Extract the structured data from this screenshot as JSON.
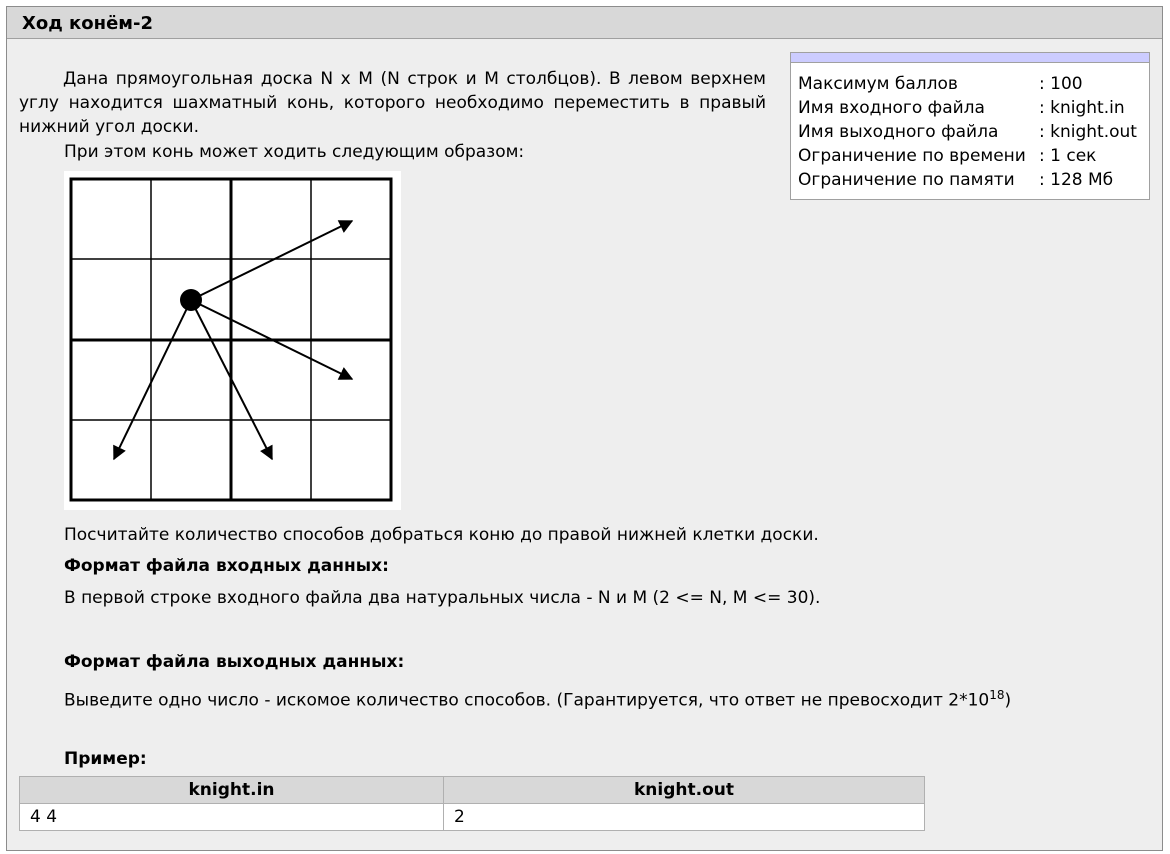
{
  "problem": {
    "title": "Ход конём-2",
    "statement_1": "Дана прямоугольная доска N x M (N строк и M столбцов). В левом верхнем углу находится шахматный конь, которого необходимо переместить в правый нижний угол доски.",
    "statement_2": "При этом конь может ходить следующим образом:",
    "statement_3": "Посчитайте количество способов добраться коню до правой нижней клетки доски.",
    "input_heading": "Формат файла входных данных:",
    "input_text": "В первой строке входного файла два натуральных числа - N и M (2 <= N, M <= 30).",
    "output_heading": "Формат файла выходных данных:",
    "output_text": "Выведите одно число - искомое количество способов. (Гарантируется, что ответ не превосходит 2*10",
    "output_exponent": "18",
    "output_close": ")",
    "example_heading": "Пример:"
  },
  "info": [
    {
      "label": "Максимум баллов",
      "value": ": 100"
    },
    {
      "label": "Имя входного файла",
      "value": ": knight.in"
    },
    {
      "label": "Имя выходного файла",
      "value": ": knight.out"
    },
    {
      "label": "Ограничение по времени",
      "value": ": 1 сек"
    },
    {
      "label": "Ограничение по памяти",
      "value": ": 128 Мб"
    }
  ],
  "example": {
    "headers": [
      "knight.in",
      "knight.out"
    ],
    "row": [
      "4 4",
      "2"
    ]
  }
}
